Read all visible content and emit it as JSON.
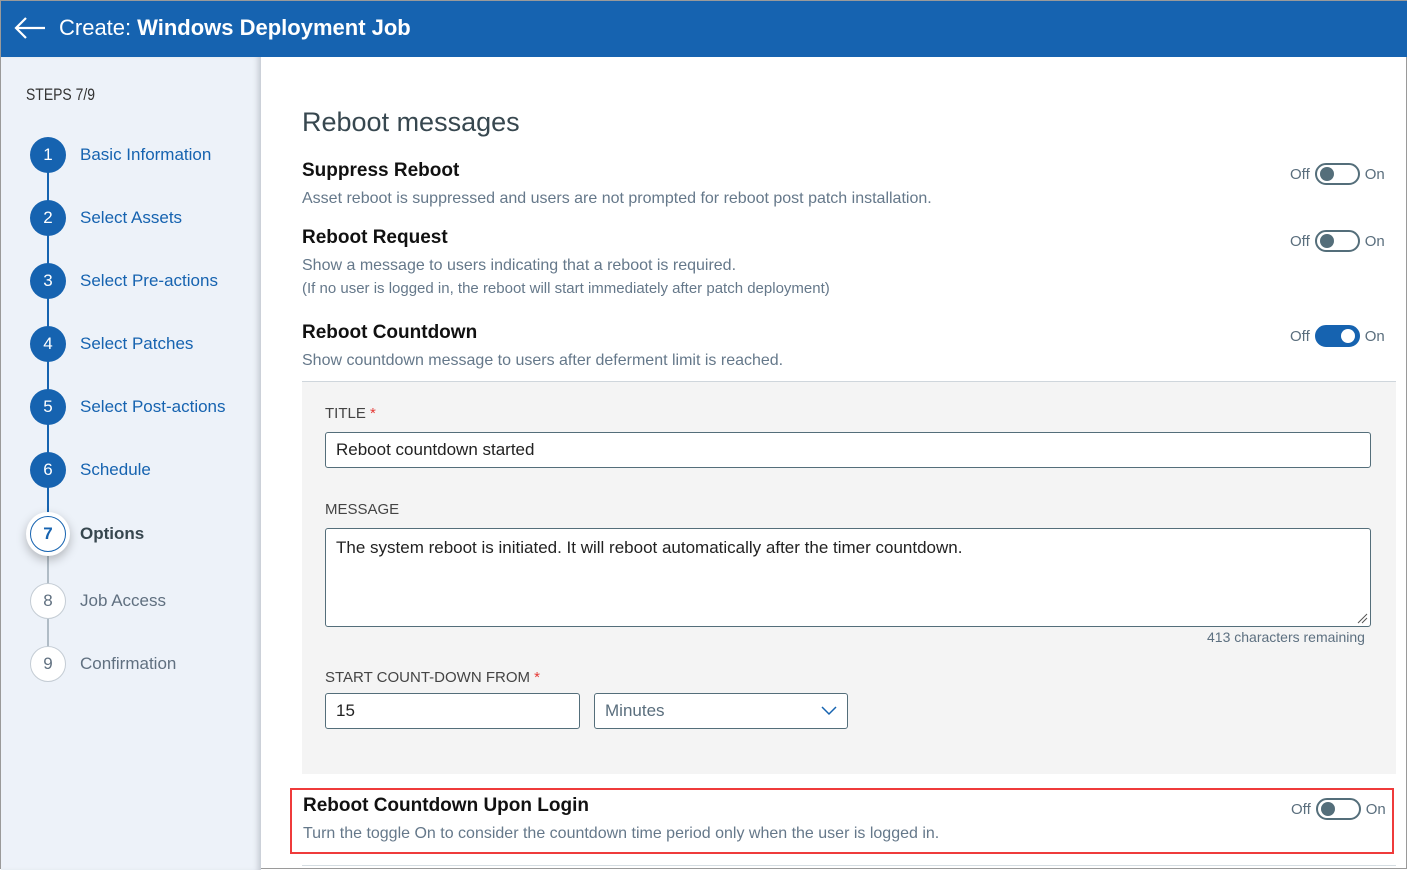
{
  "header": {
    "prefix": "Create:",
    "title": "Windows Deployment Job"
  },
  "sidebar": {
    "steps_label": "STEPS 7/9",
    "steps": [
      {
        "num": "1",
        "label": "Basic Information",
        "state": "done"
      },
      {
        "num": "2",
        "label": "Select Assets",
        "state": "done"
      },
      {
        "num": "3",
        "label": "Select Pre-actions",
        "state": "done"
      },
      {
        "num": "4",
        "label": "Select Patches",
        "state": "done"
      },
      {
        "num": "5",
        "label": "Select Post-actions",
        "state": "done"
      },
      {
        "num": "6",
        "label": "Schedule",
        "state": "done"
      },
      {
        "num": "7",
        "label": "Options",
        "state": "current"
      },
      {
        "num": "8",
        "label": "Job Access",
        "state": "todo"
      },
      {
        "num": "9",
        "label": "Confirmation",
        "state": "todo"
      }
    ]
  },
  "main": {
    "heading": "Reboot messages",
    "toggle_off": "Off",
    "toggle_on": "On",
    "settings": [
      {
        "title": "Suppress Reboot",
        "desc": "Asset reboot is suppressed and users are not prompted for reboot post patch installation.",
        "on": false
      },
      {
        "title": "Reboot Request",
        "desc": "Show a message to users indicating that a reboot is required.",
        "desc2": "(If no user is logged in, the reboot will start immediately after patch deployment)",
        "on": false
      },
      {
        "title": "Reboot Countdown",
        "desc": "Show countdown message to users after deferment limit is reached.",
        "on": true
      },
      {
        "title": "Reboot Countdown Upon Login",
        "desc": "Turn the toggle On to consider the countdown time period only when the user is logged in.",
        "on": false
      }
    ],
    "form": {
      "title_label": "TITLE",
      "title_value": "Reboot countdown started",
      "message_label": "MESSAGE",
      "message_value": "The system reboot is initiated. It will reboot automatically after the timer countdown.",
      "chars_remaining": "413 characters remaining",
      "countdown_label": "START COUNT-DOWN FROM",
      "countdown_value": "15",
      "unit_value": "Minutes",
      "required": "*"
    }
  },
  "colors": {
    "accent": "#1663b0",
    "highlight": "#ef3b3b"
  }
}
